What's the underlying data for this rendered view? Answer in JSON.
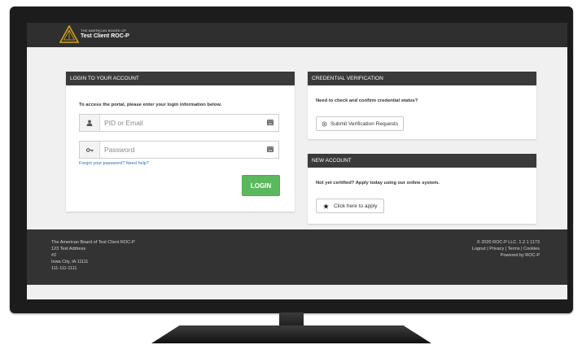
{
  "header": {
    "brand_sub": "THE AMERICAN BOARD OF",
    "brand_main": "Test Client ROC-P",
    "logo_icon": "triangle-logo-icon",
    "background": "#2f2f2f"
  },
  "login": {
    "title": "LOGIN TO YOUR ACCOUNT",
    "intro": "To access the portal, please enter your login information below.",
    "pid_placeholder": "PID or Email",
    "pid_value": "",
    "password_placeholder": "Password",
    "password_value": "",
    "forgot_text": "Forgot your password? Need help?",
    "login_label": "LOGIN",
    "login_color": "#5cb85c",
    "user_icon": "user-icon",
    "key_icon": "key-icon"
  },
  "credential": {
    "title": "CREDENTIAL VERIFICATION",
    "text": "Need to check and confirm credential status?",
    "button_label": "Submit Verification Requests",
    "button_icon": "gear-icon"
  },
  "new_account": {
    "title": "NEW ACCOUNT",
    "text": "Not yet certified? Apply today using our online system.",
    "button_label": "Click here to apply",
    "button_icon": "star-icon"
  },
  "footer": {
    "org_name": "The American Board of Test Client ROC-P",
    "address1": "123 Test Address",
    "address2": "#2",
    "city": "Iowa City, IA 11111",
    "phone": "111-111-1111",
    "copyright": "© 2020 ROC-P LLC. 1.2.1 1173",
    "link_logout": "Logout",
    "link_privacy": "Privacy",
    "link_terms": "Terms",
    "link_cookies": "Cookies",
    "separator": "|",
    "powered": "Powered by ROC-P"
  }
}
